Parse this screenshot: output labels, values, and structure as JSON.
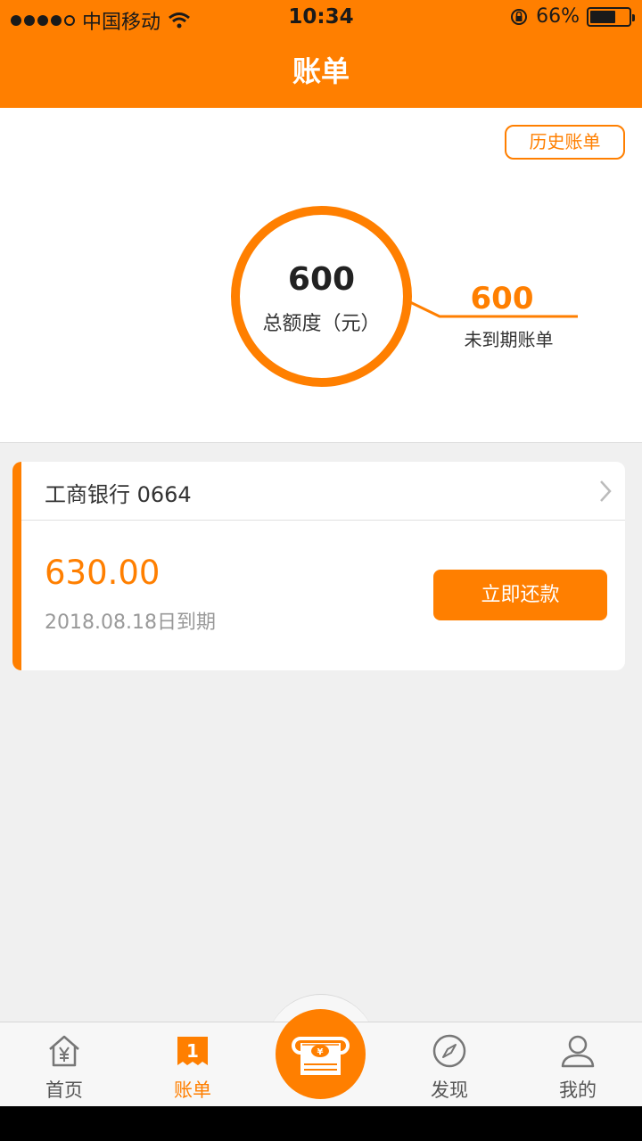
{
  "status_bar": {
    "carrier": "中国移动",
    "time": "10:34",
    "battery": "66%",
    "battery_level": 0.66
  },
  "navbar": {
    "title": "账单"
  },
  "summary": {
    "history_label": "历史账单",
    "total_amount": "600",
    "total_label": "总额度（元）",
    "due_amount": "600",
    "due_label": "未到期账单"
  },
  "bill_card": {
    "bank": "工商银行 0664",
    "amount": "630.00",
    "due_date": "2018.08.18日到期",
    "pay_label": "立即还款"
  },
  "tabbar": {
    "items": [
      {
        "label": "首页",
        "icon": "home-yen-icon"
      },
      {
        "label": "账单",
        "icon": "bill-icon",
        "badge": "1",
        "active": true
      },
      {
        "label": "",
        "icon": "cash-machine-icon"
      },
      {
        "label": "发现",
        "icon": "compass-icon"
      },
      {
        "label": "我的",
        "icon": "user-icon"
      }
    ]
  },
  "colors": {
    "accent": "#ff7f00",
    "background": "#f0f0f0"
  }
}
